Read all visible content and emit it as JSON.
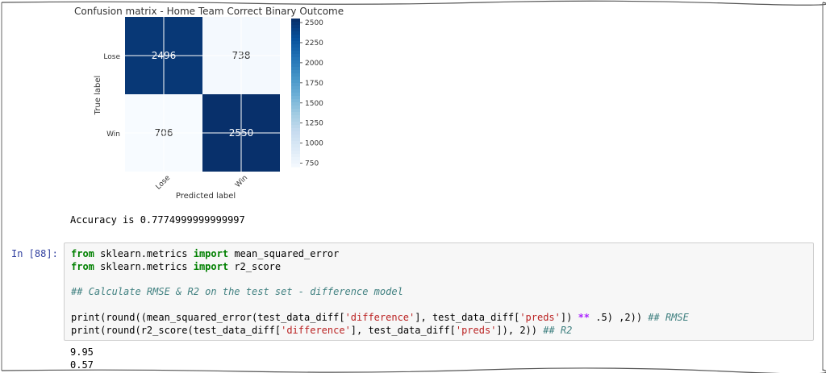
{
  "chart_data": {
    "type": "heatmap",
    "title": "Confusion matrix - Home Team Correct Binary Outcome",
    "xlabel": "Predicted label",
    "ylabel": "True label",
    "x_categories": [
      "Lose",
      "Win"
    ],
    "y_categories": [
      "Lose",
      "Win"
    ],
    "values": [
      [
        2496,
        738
      ],
      [
        706,
        2550
      ]
    ],
    "cell_labels": [
      [
        "2496",
        "738"
      ],
      [
        "706",
        "2550"
      ]
    ],
    "colorbar": {
      "ticks": [
        750,
        1000,
        1250,
        1500,
        1750,
        2000,
        2250,
        2500
      ],
      "min": 706,
      "max": 2550,
      "colormap": "Blues"
    }
  },
  "outputs": {
    "accuracy": "Accuracy is 0.7774999999999997",
    "rmse": "9.95",
    "r2": "0.57"
  },
  "cell": {
    "prompt": "In [88]:",
    "line1": {
      "kw1": "from",
      "mod": " sklearn.metrics ",
      "kw2": "import",
      "name": " mean_squared_error"
    },
    "line2": {
      "kw1": "from",
      "mod": " sklearn.metrics ",
      "kw2": "import",
      "name": " r2_score"
    },
    "comment": "## Calculate RMSE & R2 on the test set - difference model",
    "line4": {
      "p1": "print(round((mean_squared_error(test_data_diff[",
      "s1": "'difference'",
      "p2": "], test_data_diff[",
      "s2": "'preds'",
      "p3": "]) ",
      "op": "**",
      "p4": " .5) ,2)) ",
      "c": "## RMSE"
    },
    "line5": {
      "p1": "print(round(r2_score(test_data_diff[",
      "s1": "'difference'",
      "p2": "], test_data_diff[",
      "s2": "'preds'",
      "p3": "]), 2)) ",
      "c": "## R2"
    }
  }
}
